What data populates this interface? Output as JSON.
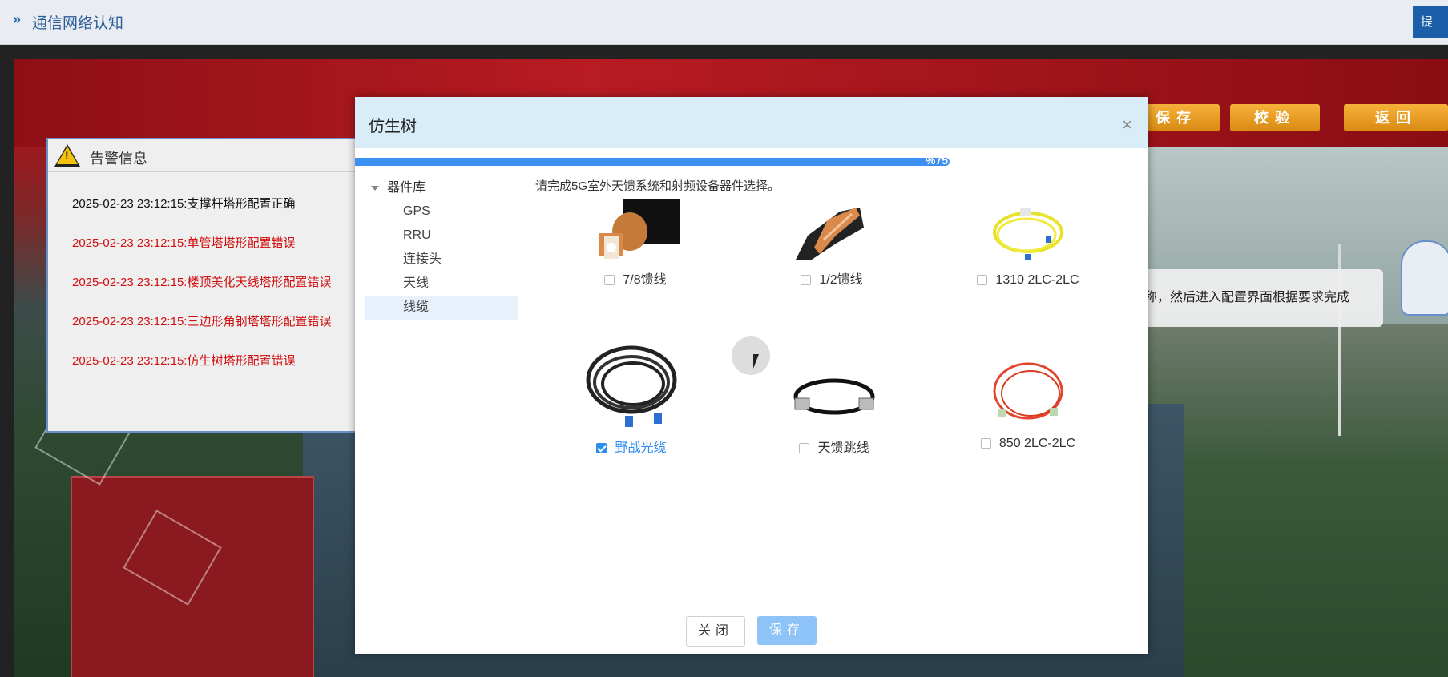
{
  "topbar": {
    "nav_icon": "»",
    "title": "通信网络认知",
    "submit_label": "提"
  },
  "actions": {
    "save": "保存",
    "verify": "校验",
    "back": "返回"
  },
  "hint": {
    "text": "称，然后进入配置界面根据要求完成"
  },
  "alarm": {
    "title": "告警信息",
    "warn_glyph": "!",
    "rows": [
      {
        "text": "2025-02-23 23:12:15:支撑杆塔形配置正确",
        "status": "ok"
      },
      {
        "text": "2025-02-23 23:12:15:单管塔塔形配置错误",
        "status": "error"
      },
      {
        "text": "2025-02-23 23:12:15:楼顶美化天线塔形配置错误",
        "status": "error"
      },
      {
        "text": "2025-02-23 23:12:15:三边形角钢塔塔形配置错误",
        "status": "error"
      },
      {
        "text": "2025-02-23 23:12:15:仿生树塔形配置错误",
        "status": "error"
      }
    ]
  },
  "modal": {
    "title": "仿生树",
    "close_icon": "×",
    "progress": {
      "label": "%75",
      "value": 100
    },
    "tree": {
      "root": "器件库",
      "items": [
        {
          "label": "GPS"
        },
        {
          "label": "RRU"
        },
        {
          "label": "连接头"
        },
        {
          "label": "天线"
        },
        {
          "label": "线缆",
          "active": true
        }
      ]
    },
    "instruction": "请完成5G室外天馈系统和射频设备器件选择。",
    "items": [
      {
        "label": "7/8馈线",
        "checked": false,
        "icon": "coax-cable-7-8-icon"
      },
      {
        "label": "1/2馈线",
        "checked": false,
        "icon": "coax-cable-1-2-icon"
      },
      {
        "label": "1310 2LC-2LC",
        "checked": false,
        "icon": "yellow-fiber-icon"
      },
      {
        "label": "野战光缆",
        "checked": true,
        "icon": "field-fiber-cable-icon"
      },
      {
        "label": "天馈跳线",
        "checked": false,
        "icon": "jumper-cable-icon"
      },
      {
        "label": "850 2LC-2LC",
        "checked": false,
        "icon": "orange-fiber-icon"
      }
    ],
    "buttons": {
      "close": "关闭",
      "save": "保存"
    }
  },
  "colors": {
    "accent": "#2d8cf0",
    "error": "#d10f0f",
    "header": "#d9edf8",
    "action": "#e89a1f"
  }
}
